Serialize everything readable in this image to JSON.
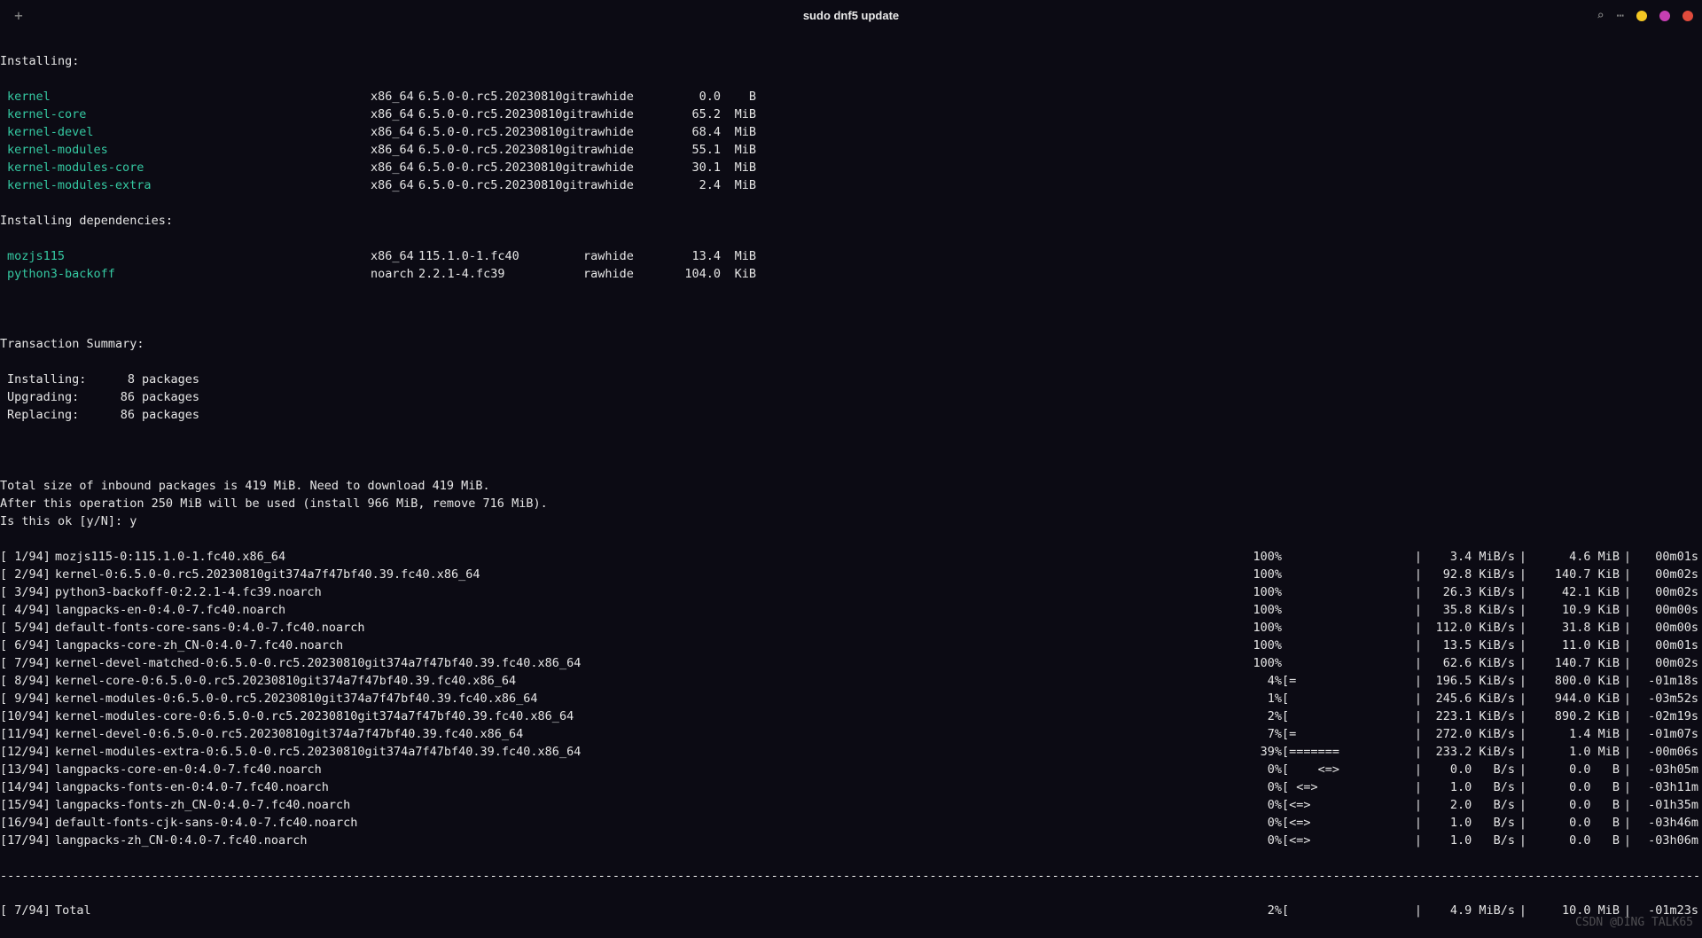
{
  "titlebar": {
    "title": "sudo dnf5 update"
  },
  "sections": {
    "installing": "Installing:",
    "installing_deps": "Installing dependencies:",
    "txn_summary": "Transaction Summary:"
  },
  "install_rows": [
    {
      "name": "kernel",
      "arch": "x86_64",
      "ver": "6.5.0-0.rc5.20230810git",
      "repo": "rawhide",
      "size": "0.0",
      "unit": "B"
    },
    {
      "name": "kernel-core",
      "arch": "x86_64",
      "ver": "6.5.0-0.rc5.20230810git",
      "repo": "rawhide",
      "size": "65.2",
      "unit": "MiB"
    },
    {
      "name": "kernel-devel",
      "arch": "x86_64",
      "ver": "6.5.0-0.rc5.20230810git",
      "repo": "rawhide",
      "size": "68.4",
      "unit": "MiB"
    },
    {
      "name": "kernel-modules",
      "arch": "x86_64",
      "ver": "6.5.0-0.rc5.20230810git",
      "repo": "rawhide",
      "size": "55.1",
      "unit": "MiB"
    },
    {
      "name": "kernel-modules-core",
      "arch": "x86_64",
      "ver": "6.5.0-0.rc5.20230810git",
      "repo": "rawhide",
      "size": "30.1",
      "unit": "MiB"
    },
    {
      "name": "kernel-modules-extra",
      "arch": "x86_64",
      "ver": "6.5.0-0.rc5.20230810git",
      "repo": "rawhide",
      "size": "2.4",
      "unit": "MiB"
    }
  ],
  "dep_rows": [
    {
      "name": "mozjs115",
      "arch": "x86_64",
      "ver": "115.1.0-1.fc40",
      "repo": "rawhide",
      "size": "13.4",
      "unit": "MiB"
    },
    {
      "name": "python3-backoff",
      "arch": "noarch",
      "ver": "2.2.1-4.fc39",
      "repo": "rawhide",
      "size": "104.0",
      "unit": "KiB"
    }
  ],
  "summary": [
    {
      "label": "Installing:",
      "count": "8",
      "word": "packages"
    },
    {
      "label": "Upgrading:",
      "count": "86",
      "word": "packages"
    },
    {
      "label": "Replacing:",
      "count": "86",
      "word": "packages"
    }
  ],
  "footer_lines": [
    "Total size of inbound packages is 419 MiB. Need to download 419 MiB.",
    "After this operation 250 MiB will be used (install 966 MiB, remove 716 MiB).",
    "Is this ok [y/N]: y"
  ],
  "downloads": [
    {
      "idx": "[ 1/94]",
      "name": "mozjs115-0:115.1.0-1.fc40.x86_64",
      "pct": "100%",
      "bar": "",
      "rate": "3.4 MiB/s",
      "size": "4.6 MiB",
      "time": "00m01s"
    },
    {
      "idx": "[ 2/94]",
      "name": "kernel-0:6.5.0-0.rc5.20230810git374a7f47bf40.39.fc40.x86_64",
      "pct": "100%",
      "bar": "",
      "rate": "92.8 KiB/s",
      "size": "140.7 KiB",
      "time": "00m02s"
    },
    {
      "idx": "[ 3/94]",
      "name": "python3-backoff-0:2.2.1-4.fc39.noarch",
      "pct": "100%",
      "bar": "",
      "rate": "26.3 KiB/s",
      "size": "42.1 KiB",
      "time": "00m02s"
    },
    {
      "idx": "[ 4/94]",
      "name": "langpacks-en-0:4.0-7.fc40.noarch",
      "pct": "100%",
      "bar": "",
      "rate": "35.8 KiB/s",
      "size": "10.9 KiB",
      "time": "00m00s"
    },
    {
      "idx": "[ 5/94]",
      "name": "default-fonts-core-sans-0:4.0-7.fc40.noarch",
      "pct": "100%",
      "bar": "",
      "rate": "112.0 KiB/s",
      "size": "31.8 KiB",
      "time": "00m00s"
    },
    {
      "idx": "[ 6/94]",
      "name": "langpacks-core-zh_CN-0:4.0-7.fc40.noarch",
      "pct": "100%",
      "bar": "",
      "rate": "13.5 KiB/s",
      "size": "11.0 KiB",
      "time": "00m01s"
    },
    {
      "idx": "[ 7/94]",
      "name": "kernel-devel-matched-0:6.5.0-0.rc5.20230810git374a7f47bf40.39.fc40.x86_64",
      "pct": "100%",
      "bar": "",
      "rate": "62.6 KiB/s",
      "size": "140.7 KiB",
      "time": "00m02s"
    },
    {
      "idx": "[ 8/94]",
      "name": "kernel-core-0:6.5.0-0.rc5.20230810git374a7f47bf40.39.fc40.x86_64",
      "pct": "4%",
      "bar": "[=                 ]",
      "rate": "196.5 KiB/s",
      "size": "800.0 KiB",
      "time": "-01m18s"
    },
    {
      "idx": "[ 9/94]",
      "name": "kernel-modules-0:6.5.0-0.rc5.20230810git374a7f47bf40.39.fc40.x86_64",
      "pct": "1%",
      "bar": "[                  ]",
      "rate": "245.6 KiB/s",
      "size": "944.0 KiB",
      "time": "-03m52s"
    },
    {
      "idx": "[10/94]",
      "name": "kernel-modules-core-0:6.5.0-0.rc5.20230810git374a7f47bf40.39.fc40.x86_64",
      "pct": "2%",
      "bar": "[                  ]",
      "rate": "223.1 KiB/s",
      "size": "890.2 KiB",
      "time": "-02m19s"
    },
    {
      "idx": "[11/94]",
      "name": "kernel-devel-0:6.5.0-0.rc5.20230810git374a7f47bf40.39.fc40.x86_64",
      "pct": "7%",
      "bar": "[=                 ]",
      "rate": "272.0 KiB/s",
      "size": "1.4 MiB",
      "time": "-01m07s"
    },
    {
      "idx": "[12/94]",
      "name": "kernel-modules-extra-0:6.5.0-0.rc5.20230810git374a7f47bf40.39.fc40.x86_64",
      "pct": "39%",
      "bar": "[=======           ]",
      "rate": "233.2 KiB/s",
      "size": "1.0 MiB",
      "time": "-00m06s"
    },
    {
      "idx": "[13/94]",
      "name": "langpacks-core-en-0:4.0-7.fc40.noarch",
      "pct": "0%",
      "bar": "[    <=>           ]",
      "rate": "0.0   B/s",
      "size": "0.0   B",
      "time": "-03h05m"
    },
    {
      "idx": "[14/94]",
      "name": "langpacks-fonts-en-0:4.0-7.fc40.noarch",
      "pct": "0%",
      "bar": "[ <=>              ]",
      "rate": "1.0   B/s",
      "size": "0.0   B",
      "time": "-03h11m"
    },
    {
      "idx": "[15/94]",
      "name": "langpacks-fonts-zh_CN-0:4.0-7.fc40.noarch",
      "pct": "0%",
      "bar": "[<=>               ]",
      "rate": "2.0   B/s",
      "size": "0.0   B",
      "time": "-01h35m"
    },
    {
      "idx": "[16/94]",
      "name": "default-fonts-cjk-sans-0:4.0-7.fc40.noarch",
      "pct": "0%",
      "bar": "[<=>               ]",
      "rate": "1.0   B/s",
      "size": "0.0   B",
      "time": "-03h46m"
    },
    {
      "idx": "[17/94]",
      "name": "langpacks-zh_CN-0:4.0-7.fc40.noarch",
      "pct": "0%",
      "bar": "[<=>               ]",
      "rate": "1.0   B/s",
      "size": "0.0   B",
      "time": "-03h06m"
    }
  ],
  "total": {
    "idx": "[ 7/94]",
    "name": "Total",
    "pct": "2%",
    "bar": "[                  ]",
    "rate": "4.9 MiB/s",
    "size": "10.0 MiB",
    "time": "-01m23s"
  },
  "watermark": "CSDN @DING TALK65"
}
